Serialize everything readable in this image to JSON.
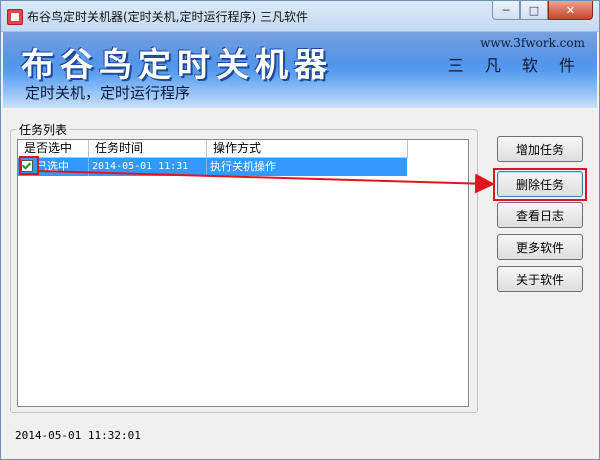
{
  "window": {
    "title": "布谷鸟定时关机器(定时关机,定时运行程序) 三凡软件",
    "controls": {
      "minimize": "─",
      "maximize": "□",
      "close": "✕"
    }
  },
  "banner": {
    "title": "布谷鸟定时关机器",
    "subtitle": "定时关机，定时运行程序",
    "url": "www.3fwork.com",
    "brand": "三 凡 软 件"
  },
  "tasks": {
    "group_label": "任务列表",
    "columns": [
      "是否选中",
      "任务时间",
      "操作方式"
    ],
    "rows": [
      {
        "selected": "已选中",
        "time": "2014-05-01 11:31",
        "action": "执行关机操作"
      }
    ]
  },
  "buttons": {
    "add": "增加任务",
    "delete": "删除任务",
    "log": "查看日志",
    "more": "更多软件",
    "about": "关于软件"
  },
  "status": {
    "datetime": "2014-05-01 11:32:01"
  },
  "colors": {
    "annotation": "#e3141b",
    "selection": "#3399ff",
    "banner": "#2f6fd1"
  }
}
